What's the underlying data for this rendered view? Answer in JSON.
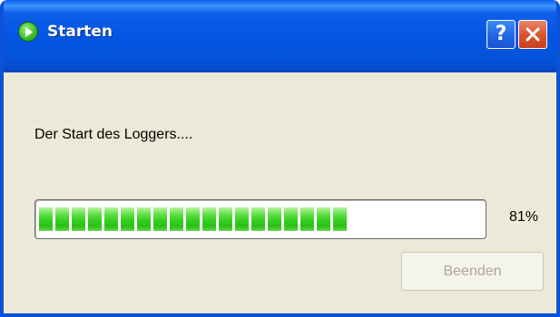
{
  "window": {
    "title": "Starten",
    "help_label": "?",
    "close_icon": "close-icon",
    "title_icon": "play-icon"
  },
  "main": {
    "message": "Der Start des Loggers....",
    "progress": {
      "fraction": 0.81,
      "label": "81%",
      "segments_total": 23,
      "segments_filled": 19
    },
    "button_label": "Beenden",
    "button_enabled": false
  },
  "colors": {
    "titlebar": "#0355E3",
    "body": "#ECE9D8",
    "progress_fill": "#35CF1F",
    "close": "#D8532D",
    "disabled_text": "#ACA899"
  }
}
